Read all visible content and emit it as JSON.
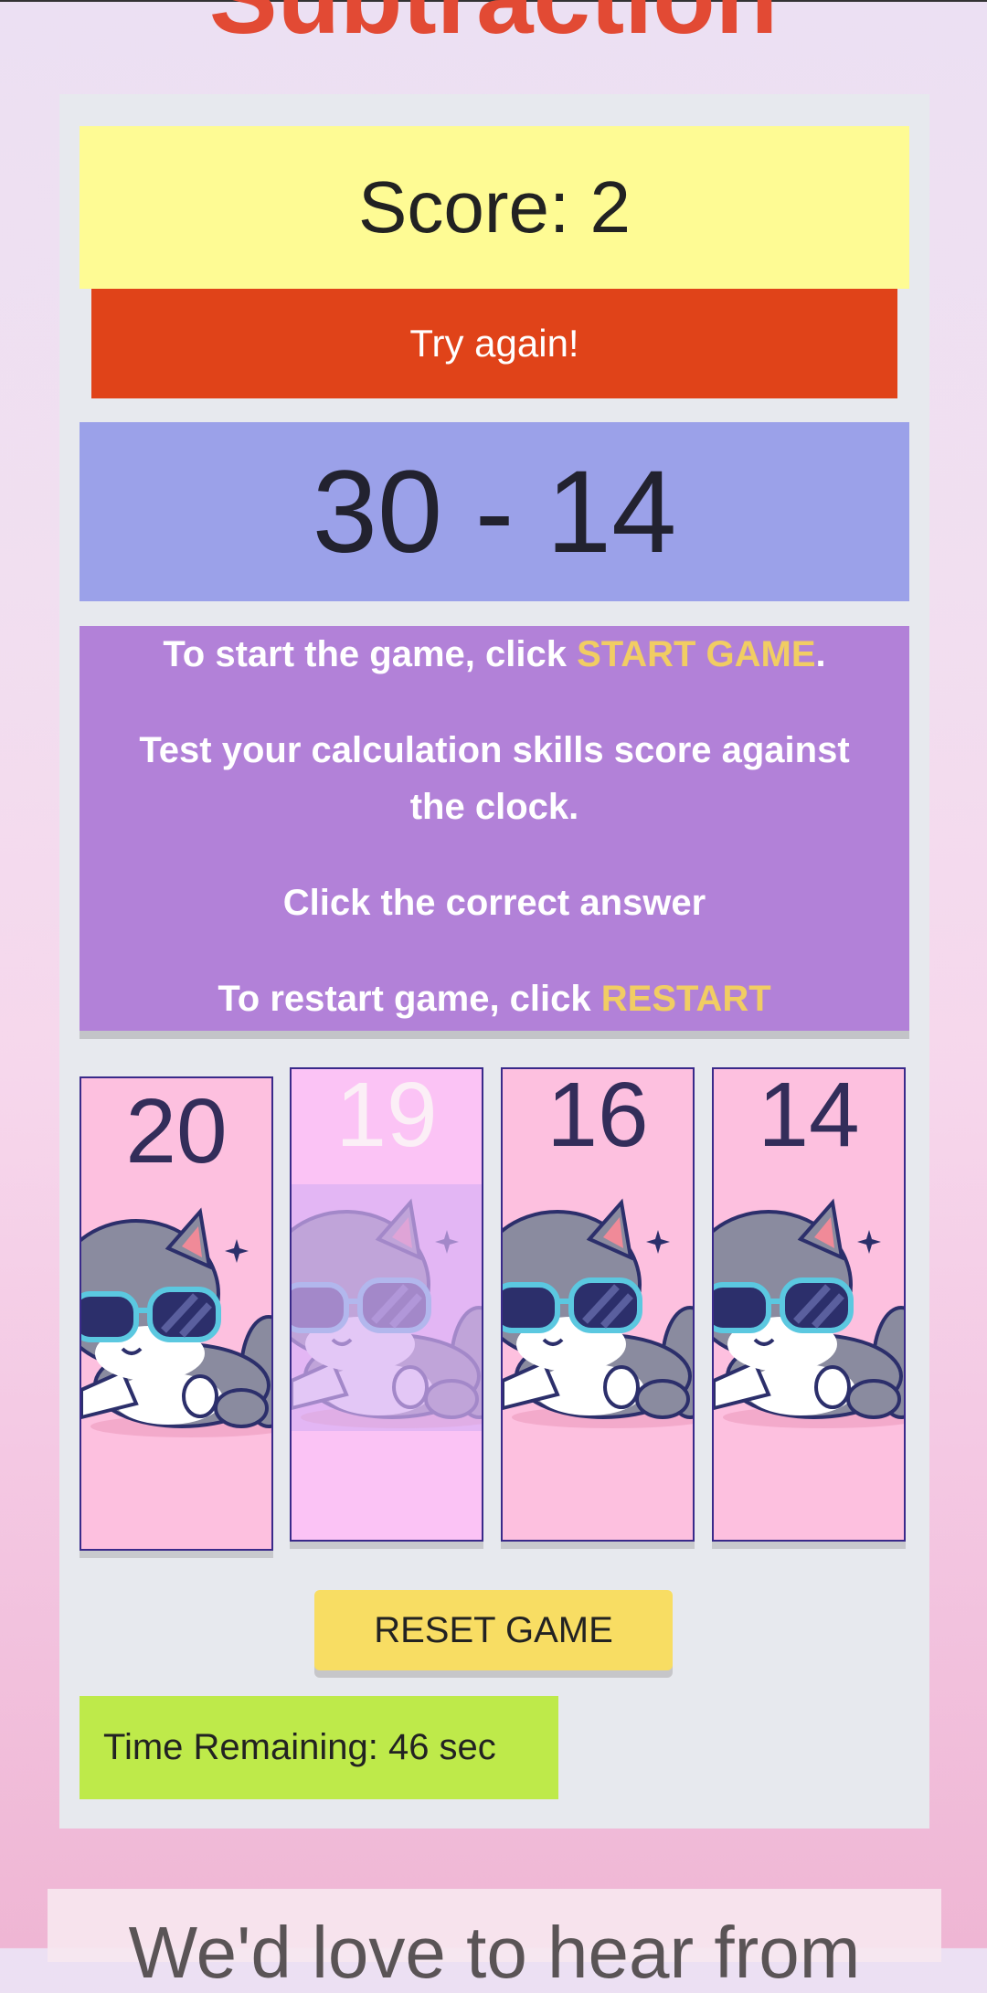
{
  "page": {
    "title": "Subtraction"
  },
  "game": {
    "score": "Score: 2",
    "feedback": "Try again!",
    "question": "30 - 14",
    "instructions": {
      "line1_prefix": "To start the game, click ",
      "line1_highlight": "START GAME",
      "line1_suffix": ".",
      "line2": "Test your calculation skills score against the clock.",
      "line3": "Click the correct answer",
      "line4_prefix": "To restart game, click ",
      "line4_highlight": "RESTART"
    },
    "answers": [
      {
        "value": "20"
      },
      {
        "value": "19"
      },
      {
        "value": "16"
      },
      {
        "value": "14"
      }
    ],
    "reset_label": "RESET GAME",
    "timer": "Time Remaining: 46 sec"
  },
  "contact": {
    "title": "We'd love to hear from"
  },
  "colors": {
    "score_bg": "#fefb94",
    "feedback_bg": "#e04319",
    "question_bg": "#9ba1e9",
    "instructions_bg": "#b281d8",
    "highlight": "#f1cd63",
    "card_bg": "#fdc0df",
    "card_selected_bg": "#fbc3f5",
    "reset_bg": "#f8dd63",
    "timer_bg": "#beea4a"
  },
  "icons": {
    "card_image": "cat-with-sunglasses-icon"
  }
}
